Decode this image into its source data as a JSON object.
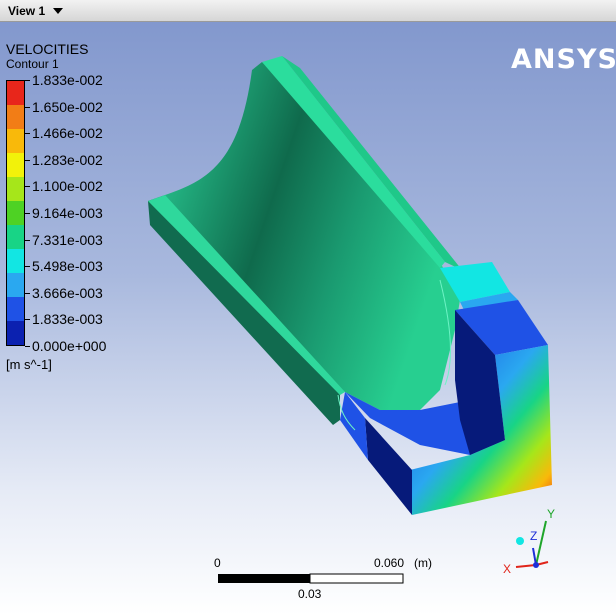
{
  "viewport": {
    "tab_label": "View 1"
  },
  "brand": {
    "logo_text": "ANSYS"
  },
  "legend": {
    "title": "VELOCITIES",
    "subtitle": "Contour 1",
    "unit": "[m s^-1]",
    "levels": [
      "1.833e-002",
      "1.650e-002",
      "1.466e-002",
      "1.283e-002",
      "1.100e-002",
      "9.164e-003",
      "7.331e-003",
      "5.498e-003",
      "3.666e-003",
      "1.833e-003",
      "0.000e+000"
    ],
    "colors": [
      "#e8261b",
      "#f27d16",
      "#f9b90a",
      "#f2f20a",
      "#a6e61a",
      "#4ed224",
      "#18d486",
      "#12e6e3",
      "#2aa8f0",
      "#1f52e6",
      "#0b21b0"
    ]
  },
  "scale": {
    "start_label": "0",
    "end_label": "0.060",
    "unit_label": "(m)",
    "mid_label": "0.03"
  },
  "triad": {
    "x_label": "X",
    "y_label": "Y",
    "z_label": "Z",
    "x_color": "#e0241a",
    "y_color": "#1ea52a",
    "z_color": "#1d2fd8"
  },
  "model": {
    "surface_color": "#21d08e",
    "inner_shade": "#0f6a4c",
    "low_region": "#1842e0",
    "dark_face": "#061a7a"
  }
}
